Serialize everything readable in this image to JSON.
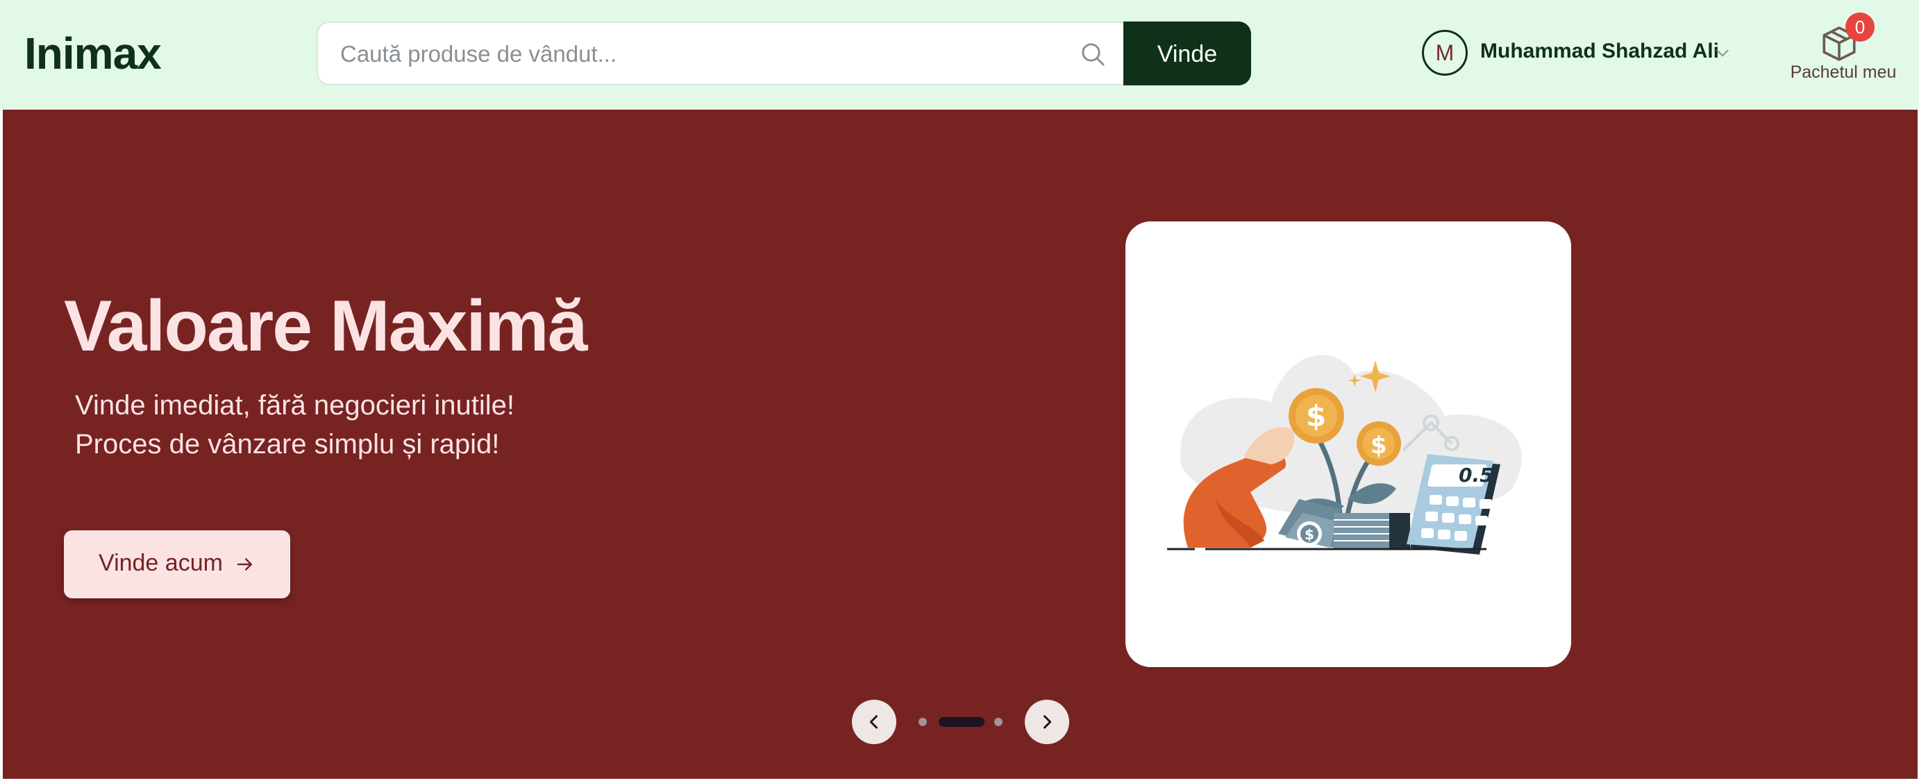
{
  "header": {
    "logo": "Inimax",
    "search": {
      "placeholder": "Caută produse de vândut...",
      "value": ""
    },
    "sell_button": "Vinde",
    "user": {
      "avatar_initial": "M",
      "name": "Muhammad Shahzad Ali"
    },
    "bundle": {
      "label": "Pachetul meu",
      "count": "0"
    }
  },
  "hero": {
    "title": "Valoare Maximă",
    "lines": [
      "Vinde imediat, fără negocieri inutile!",
      "Proces de vânzare simplu și rapid!"
    ],
    "cta_label": "Vinde acum",
    "illustration_text": "0.5",
    "carousel": {
      "slides": 3,
      "active_index": 1
    }
  },
  "colors": {
    "header_bg": "#e2f9e8",
    "brand_dark": "#0f3019",
    "hero_bg": "#772322",
    "hero_text": "#fbe3e4",
    "badge": "#e8443f"
  },
  "icons": [
    "search-icon",
    "chevron-down-icon",
    "box-icon",
    "arrow-right-icon",
    "chevron-left-icon",
    "chevron-right-icon"
  ]
}
